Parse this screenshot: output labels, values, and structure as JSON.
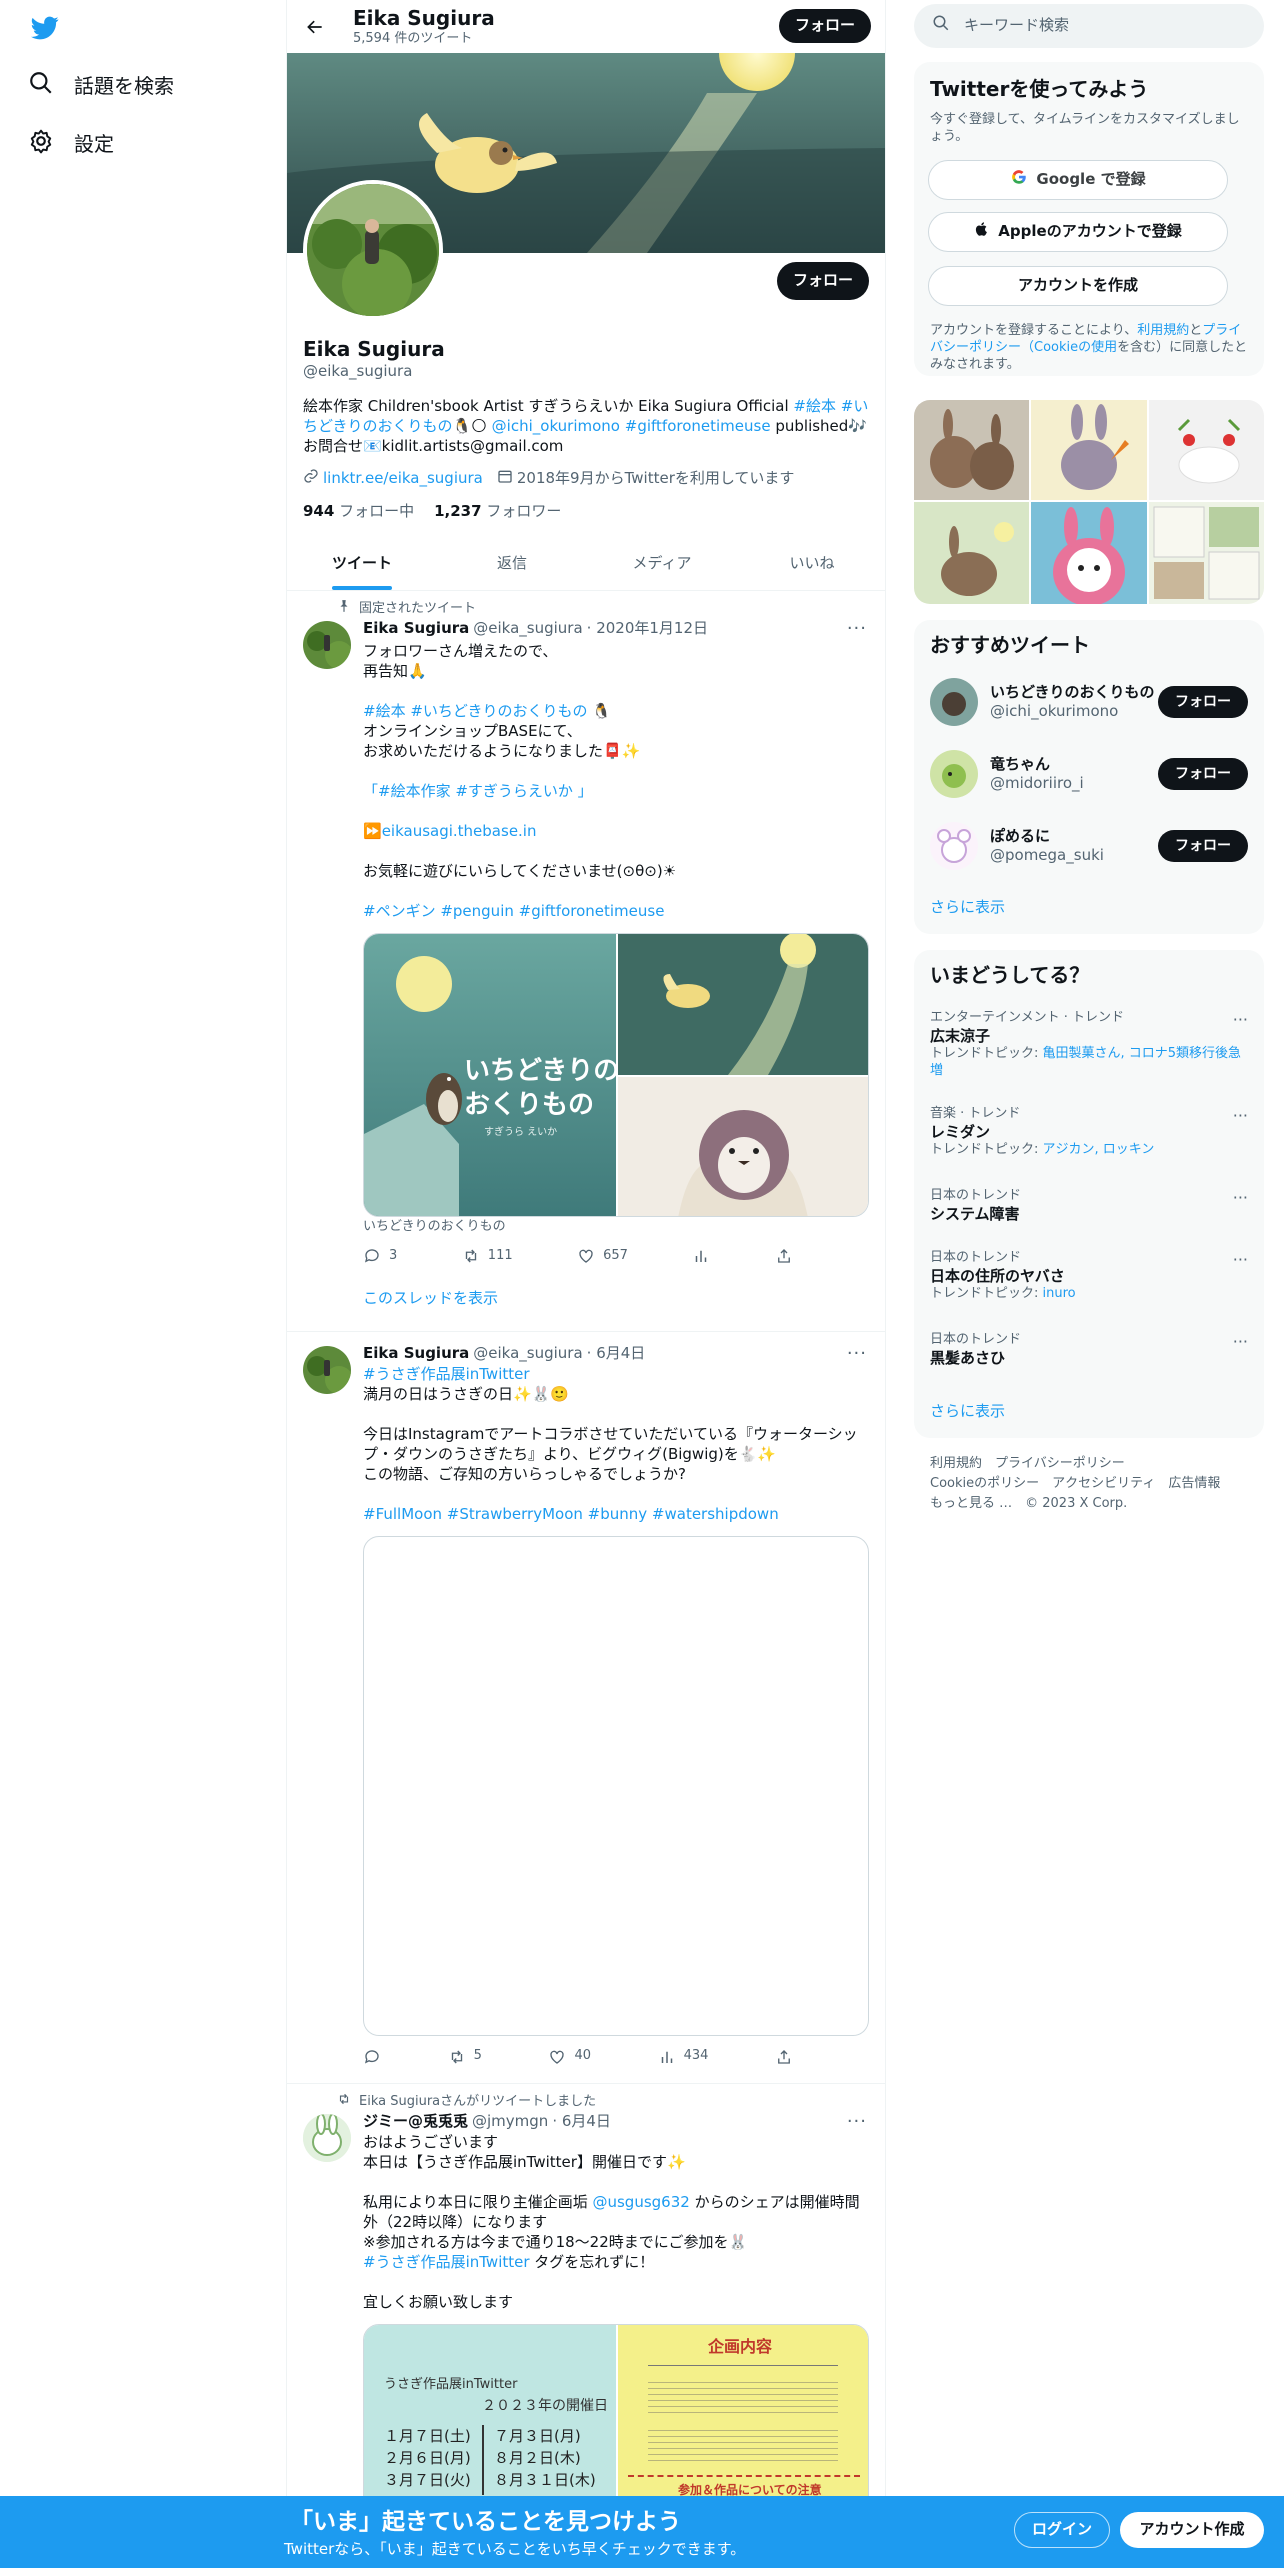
{
  "nav": {
    "explore_label": "話題を検索",
    "settings_label": "設定"
  },
  "header": {
    "name": "Eika Sugiura",
    "tweet_count": "5,594 件のツイート",
    "follow_label": "フォロー"
  },
  "profile": {
    "follow_label": "フォロー",
    "name": "Eika Sugiura",
    "handle": "@eika_sugiura",
    "bio_line1": "絵本作家 Children'sbook Artist すぎうらえいか Eika Sugiura Official ",
    "bio_tag1": "#絵本",
    "bio_tag2": "#いちどきりのおくりもの",
    "bio_emoji1": "🐧🌕",
    "bio_mention": "@ichi_okurimono",
    "bio_tag3": "#giftforonetimeuse",
    "bio_published": " published🎶",
    "bio_line2": "お問合せ📧kidlit.artists@gmail.com",
    "link": "linktr.ee/eika_sugiura",
    "joined": "2018年9月からTwitterを利用しています",
    "following_count": "944",
    "following_label": "フォロー中",
    "followers_count": "1,237",
    "followers_label": "フォロワー"
  },
  "tabs": [
    "ツイート",
    "返信",
    "メディア",
    "いいね"
  ],
  "tweets": [
    {
      "pinned_label": "固定されたツイート",
      "name": "Eika Sugiura",
      "handle": "@eika_sugiura",
      "date": "· 2020年1月12日",
      "line1": "フォロワーさん増えたので、",
      "line2": "再告知🙏",
      "tags1": "#絵本 #いちどきりのおくりもの",
      "tags1_emoji": " 🐧",
      "line3": "オンラインショップBASEにて、",
      "line4": "お求めいただけるようになりました📮✨",
      "quote": "「#絵本作家 #すぎうらえいか 」",
      "link_emoji": "⏩",
      "link": "eikausagi.thebase.in",
      "line5": "お気軽に遊びにいらしてくださいませ(⊙θ⊙)☀",
      "tags2": "#ペンギン #penguin #giftforonetimeuse",
      "book_title": "いちどきりの\nおくりもの",
      "book_author": "すぎうら えいか",
      "caption": "いちどきりのおくりもの",
      "replies": "3",
      "retweets": "111",
      "likes": "657",
      "thread_label": "このスレッドを表示"
    },
    {
      "name": "Eika Sugiura",
      "handle": "@eika_sugiura",
      "date": "· 6月4日",
      "tag_top": "#うさぎ作品展inTwitter",
      "line1": "満月の日はうさぎの日✨🐰🙂",
      "line2": "今日はInstagramでアートコラボさせていただいている『ウォーターシップ・ダウンのうさぎたち』より、ビグウィグ(Bigwig)を🐇✨",
      "line3": "この物語、ご存知の方いらっしゃるでしょうか?",
      "tags": "#FullMoon #StrawberryMoon #bunny #watershipdown",
      "retweets": "5",
      "likes": "40",
      "views": "434"
    },
    {
      "social": "Eika Sugiuraさんがリツイートしました",
      "name": "ジミー@兎兎兎",
      "handle": "@jmymgn",
      "date": "· 6月4日",
      "line1": "おはようございます",
      "line2": "本日は【うさぎ作品展inTwitter】開催日です✨",
      "line3a": "私用により本日に限り主催企画垢 ",
      "mention": "@usgusg632",
      "line3b": " からのシェアは開催時間外（22時以降）になります",
      "line4": "※参加される方は今まで通り18〜22時までにご参加を🐰",
      "tag": "#うさぎ作品展inTwitter",
      "line5": " タグを忘れずに！",
      "line6": "宜しくお願い致します",
      "poster_title": "うさぎ作品展inTwitter",
      "poster_year": "２０２３年の開催日",
      "dates_left": [
        "１月７日(土)",
        "２月６日(月)",
        "３月７日(火)"
      ],
      "dates_right": [
        "７月３日(月)",
        "８月２日(木)",
        "８月３１日(木)"
      ],
      "poster_heading": "企画内容",
      "poster_footer": "参加＆作品についての注意"
    }
  ],
  "right": {
    "search_placeholder": "キーワード検索",
    "signup_title": "Twitterを使ってみよう",
    "signup_sub": "今すぐ登録して、タイムラインをカスタマイズしましょう。",
    "google_label": "Google で登録",
    "apple_label": "Appleのアカウントで登録",
    "create_label": "アカウントを作成",
    "terms_pre": "アカウントを登録することにより、",
    "terms_link1": "利用規約",
    "terms_mid": "と",
    "terms_link2": "プライバシーポリシー（Cookieの使用",
    "terms_post": "を含む）に同意したとみなされます。",
    "rec_title": "おすすめツイート",
    "recs": [
      {
        "name": "いちどきりのおくりもの",
        "handle": "@ichi_okurimono",
        "btn": "フォロー"
      },
      {
        "name": "竜ちゃん",
        "handle": "@midoriiro_i",
        "btn": "フォロー"
      },
      {
        "name": "ぽめるに",
        "handle": "@pomega_suki",
        "btn": "フォロー"
      }
    ],
    "show_more": "さらに表示",
    "trends_title": "いまどうしてる？",
    "trends": [
      {
        "cat": "エンターテインメント · トレンド",
        "title": "広末涼子",
        "sub_pre": "トレンドトピック: ",
        "sub_link": "亀田製菓さん, コロナ5類移行後急増"
      },
      {
        "cat": "音楽 · トレンド",
        "title": "レミダン",
        "sub_pre": "トレンドトピック: ",
        "sub_link": "アジカン, ロッキン"
      },
      {
        "cat": "日本のトレンド",
        "title": "システム障害",
        "sub_pre": "",
        "sub_link": ""
      },
      {
        "cat": "日本のトレンド",
        "title": "日本の住所のヤバさ",
        "sub_pre": "トレンドトピック: ",
        "sub_link": "inuro"
      },
      {
        "cat": "日本のトレンド",
        "title": "黒髪あさひ",
        "sub_pre": "",
        "sub_link": ""
      }
    ],
    "trends_more": "さらに表示",
    "footer_line1": "利用規約　プライバシーポリシー",
    "footer_line2": "Cookieのポリシー　アクセシビリティ　広告情報",
    "footer_line3": "もっと見る …　© 2023 X Corp."
  },
  "bottom": {
    "title": "「いま」起きていることを見つけよう",
    "sub": "Twitterなら、「いま」起きていることをいち早くチェックできます。",
    "login": "ログイン",
    "signup": "アカウント作成"
  }
}
